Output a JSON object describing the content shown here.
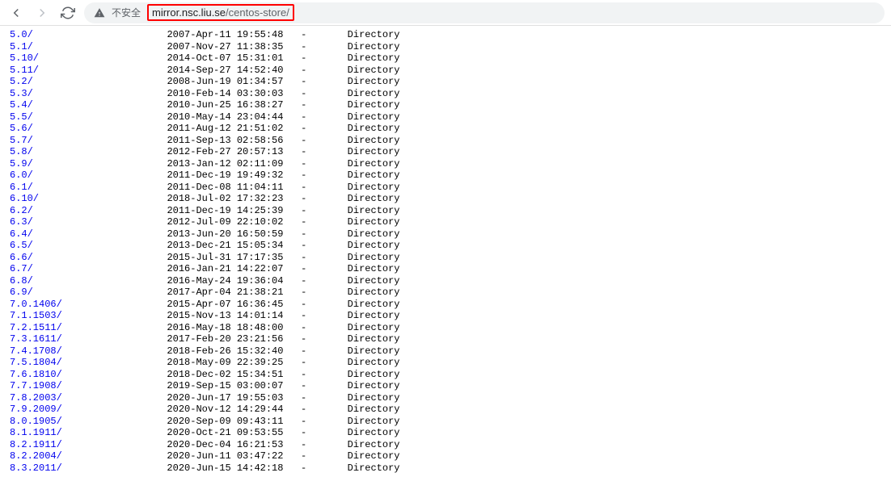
{
  "browser": {
    "security_label": "不安全",
    "url_domain": "mirror.nsc.liu.se",
    "url_path": "/centos-store/"
  },
  "listing": [
    {
      "name": "5.0/",
      "date": "2007-Apr-11 19:55:48",
      "size": "-",
      "type": "Directory",
      "partial": true
    },
    {
      "name": "5.1/",
      "date": "2007-Nov-27 11:38:35",
      "size": "-",
      "type": "Directory"
    },
    {
      "name": "5.10/",
      "date": "2014-Oct-07 15:31:01",
      "size": "-",
      "type": "Directory"
    },
    {
      "name": "5.11/",
      "date": "2014-Sep-27 14:52:40",
      "size": "-",
      "type": "Directory"
    },
    {
      "name": "5.2/",
      "date": "2008-Jun-19 01:34:57",
      "size": "-",
      "type": "Directory"
    },
    {
      "name": "5.3/",
      "date": "2010-Feb-14 03:30:03",
      "size": "-",
      "type": "Directory"
    },
    {
      "name": "5.4/",
      "date": "2010-Jun-25 16:38:27",
      "size": "-",
      "type": "Directory"
    },
    {
      "name": "5.5/",
      "date": "2010-May-14 23:04:44",
      "size": "-",
      "type": "Directory"
    },
    {
      "name": "5.6/",
      "date": "2011-Aug-12 21:51:02",
      "size": "-",
      "type": "Directory"
    },
    {
      "name": "5.7/",
      "date": "2011-Sep-13 02:58:56",
      "size": "-",
      "type": "Directory"
    },
    {
      "name": "5.8/",
      "date": "2012-Feb-27 20:57:13",
      "size": "-",
      "type": "Directory"
    },
    {
      "name": "5.9/",
      "date": "2013-Jan-12 02:11:09",
      "size": "-",
      "type": "Directory"
    },
    {
      "name": "6.0/",
      "date": "2011-Dec-19 19:49:32",
      "size": "-",
      "type": "Directory"
    },
    {
      "name": "6.1/",
      "date": "2011-Dec-08 11:04:11",
      "size": "-",
      "type": "Directory"
    },
    {
      "name": "6.10/",
      "date": "2018-Jul-02 17:32:23",
      "size": "-",
      "type": "Directory"
    },
    {
      "name": "6.2/",
      "date": "2011-Dec-19 14:25:39",
      "size": "-",
      "type": "Directory"
    },
    {
      "name": "6.3/",
      "date": "2012-Jul-09 22:10:02",
      "size": "-",
      "type": "Directory"
    },
    {
      "name": "6.4/",
      "date": "2013-Jun-20 16:50:59",
      "size": "-",
      "type": "Directory"
    },
    {
      "name": "6.5/",
      "date": "2013-Dec-21 15:05:34",
      "size": "-",
      "type": "Directory"
    },
    {
      "name": "6.6/",
      "date": "2015-Jul-31 17:17:35",
      "size": "-",
      "type": "Directory"
    },
    {
      "name": "6.7/",
      "date": "2016-Jan-21 14:22:07",
      "size": "-",
      "type": "Directory"
    },
    {
      "name": "6.8/",
      "date": "2016-May-24 19:36:04",
      "size": "-",
      "type": "Directory"
    },
    {
      "name": "6.9/",
      "date": "2017-Apr-04 21:38:21",
      "size": "-",
      "type": "Directory"
    },
    {
      "name": "7.0.1406/",
      "date": "2015-Apr-07 16:36:45",
      "size": "-",
      "type": "Directory"
    },
    {
      "name": "7.1.1503/",
      "date": "2015-Nov-13 14:01:14",
      "size": "-",
      "type": "Directory"
    },
    {
      "name": "7.2.1511/",
      "date": "2016-May-18 18:48:00",
      "size": "-",
      "type": "Directory"
    },
    {
      "name": "7.3.1611/",
      "date": "2017-Feb-20 23:21:56",
      "size": "-",
      "type": "Directory"
    },
    {
      "name": "7.4.1708/",
      "date": "2018-Feb-26 15:32:40",
      "size": "-",
      "type": "Directory"
    },
    {
      "name": "7.5.1804/",
      "date": "2018-May-09 22:39:25",
      "size": "-",
      "type": "Directory"
    },
    {
      "name": "7.6.1810/",
      "date": "2018-Dec-02 15:34:51",
      "size": "-",
      "type": "Directory"
    },
    {
      "name": "7.7.1908/",
      "date": "2019-Sep-15 03:00:07",
      "size": "-",
      "type": "Directory"
    },
    {
      "name": "7.8.2003/",
      "date": "2020-Jun-17 19:55:03",
      "size": "-",
      "type": "Directory"
    },
    {
      "name": "7.9.2009/",
      "date": "2020-Nov-12 14:29:44",
      "size": "-",
      "type": "Directory"
    },
    {
      "name": "8.0.1905/",
      "date": "2020-Sep-09 09:43:11",
      "size": "-",
      "type": "Directory"
    },
    {
      "name": "8.1.1911/",
      "date": "2020-Oct-21 09:53:55",
      "size": "-",
      "type": "Directory"
    },
    {
      "name": "8.2.1911/",
      "date": "2020-Dec-04 16:21:53",
      "size": "-",
      "type": "Directory"
    },
    {
      "name": "8.2.2004/",
      "date": "2020-Jun-11 03:47:22",
      "size": "-",
      "type": "Directory"
    },
    {
      "name": "8.3.2011/",
      "date": "2020-Jun-15 14:42:18",
      "size": "-",
      "type": "Directory"
    }
  ]
}
